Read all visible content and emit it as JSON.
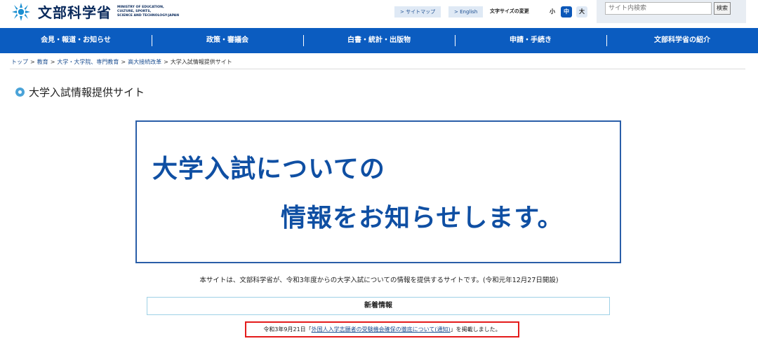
{
  "header": {
    "logo_name": "文部科学省",
    "logo_sub": [
      "MINISTRY OF EDUCATION,",
      "CULTURE, SPORTS,",
      "SCIENCE AND TECHNOLOGY-JAPAN"
    ],
    "sitemap_label": "> サイトマップ",
    "english_label": "> English",
    "font_size_label": "文字サイズの変更",
    "font_small": "小",
    "font_medium": "中",
    "font_large": "大",
    "search_placeholder": "サイト内検索",
    "search_button": "検索"
  },
  "nav": {
    "items": [
      "会見・報道・お知らせ",
      "政策・審議会",
      "白書・統計・出版物",
      "申請・手続き",
      "文部科学省の紹介"
    ]
  },
  "breadcrumb": {
    "items": [
      "トップ",
      "教育",
      "大学・大学院、専門教育",
      "高大接続改革"
    ],
    "current": "大学入試情報提供サイト",
    "separator": ">"
  },
  "page": {
    "title": "大学入試情報提供サイト"
  },
  "banner": {
    "line1": "大学入試についての",
    "line2": "情報をお知らせします。"
  },
  "intro": "本サイトは、文部科学省が、令和3年度からの大学入試についての情報を提供するサイトです。(令和元年12月27日開設)",
  "news": {
    "heading": "新着情報",
    "item_prefix": "令和3年9月21日「",
    "item_link": "外国人入学志願者の受験機会確保の徹底について(通知)",
    "item_suffix": "」を掲載しました。"
  },
  "colors": {
    "nav_bg": "#0b5cc0",
    "banner_text": "#0f4fa3",
    "highlight_border": "#e41b1b"
  }
}
